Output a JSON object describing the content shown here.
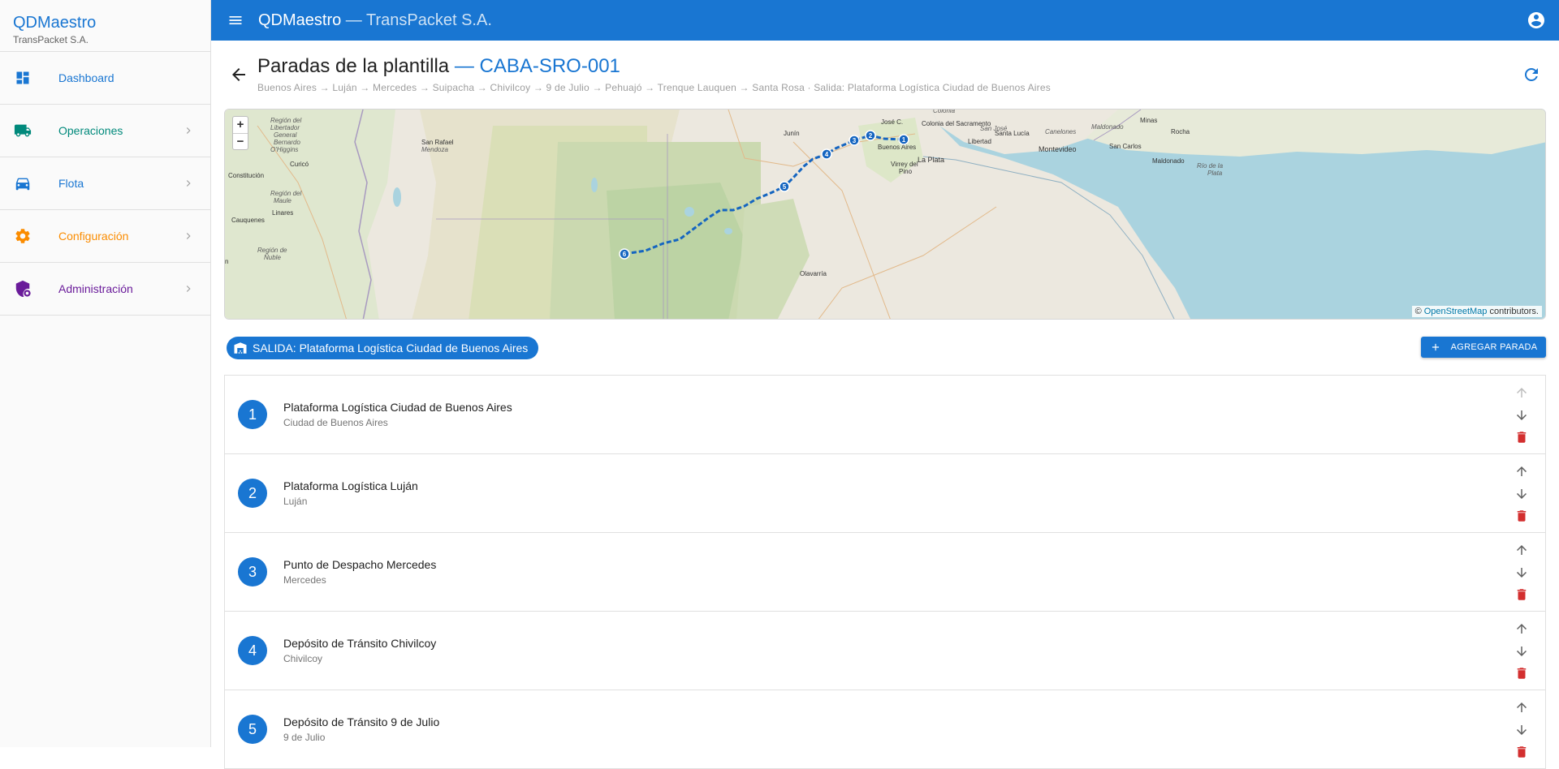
{
  "sidebar": {
    "brand_title": "QDMaestro",
    "brand_subtitle": "TransPacket S.A.",
    "items": [
      {
        "label": "Dashboard",
        "icon": "dashboard-icon",
        "color": "#1976d2"
      },
      {
        "label": "Operaciones",
        "icon": "truck-icon",
        "color": "#00897b"
      },
      {
        "label": "Flota",
        "icon": "car-icon",
        "color": "#1976d2"
      },
      {
        "label": "Configuración",
        "icon": "gear-icon",
        "color": "#fb8c00"
      },
      {
        "label": "Administración",
        "icon": "admin-shield-icon",
        "color": "#6a1b9a"
      }
    ]
  },
  "topbar": {
    "app_name": "QDMaestro",
    "company": " — TransPacket S.A.",
    "color": "#1976d2"
  },
  "page": {
    "title": "Paradas de la plantilla",
    "code": " — CABA-SRO-001",
    "route_summary": "Buenos Aires → Luján → Mercedes → Suipacha → Chivilcoy → 9 de Julio → Pehuajó → Trenque Lauquen → Santa Rosa · Salida: Plataforma Logística Ciudad de Buenos Aires"
  },
  "map": {
    "zoom_in": "+",
    "zoom_out": "−",
    "attribution_prefix": "© ",
    "attribution_link": "OpenStreetMap",
    "attribution_suffix": " contributors.",
    "labels": {
      "colonia": "Colonia",
      "colonia_sacramento": "Colonia del Sacramento",
      "san_jose": "San José",
      "santa_lucia": "Santa Lucía",
      "canelones": "Canelones",
      "maldonado_dept": "Maldonado",
      "minas": "Minas",
      "rocha": "Rocha",
      "libertad": "Libertad",
      "montevideo": "Montevideo",
      "san_carlos": "San Carlos",
      "maldonado": "Maldonado",
      "rio_plata": "Río de la Plata",
      "buenos_aires": "Buenos Aires",
      "virrey_del_pino": "Virrey del Pino",
      "la_plata": "La Plata",
      "jose_c": "José C.",
      "junin": "Junín",
      "san_rafael": "San Rafael",
      "mendoza": "Mendoza",
      "curico": "Curicó",
      "libertador": "Región del Libertador General Bernardo O'Higgins",
      "constitucion": "Constitución",
      "maule": "Región del Maule",
      "linares": "Linares",
      "cauquenes": "Cauquenes",
      "nuble": "Región de Ñuble",
      "olavarria": "Olavarría"
    },
    "markers": [
      "1",
      "2",
      "3",
      "4",
      "5",
      "6"
    ],
    "route_color": "#1565c0"
  },
  "departure_chip": "SALIDA: Plataforma Logística Ciudad de Buenos Aires",
  "add_button": "AGREGAR PARADA",
  "stops": [
    {
      "number": "1",
      "name": "Plataforma Logística Ciudad de Buenos Aires",
      "city": "Ciudad de Buenos Aires"
    },
    {
      "number": "2",
      "name": "Plataforma Logística Luján",
      "city": "Luján"
    },
    {
      "number": "3",
      "name": "Punto de Despacho Mercedes",
      "city": "Mercedes"
    },
    {
      "number": "4",
      "name": "Depósito de Tránsito Chivilcoy",
      "city": "Chivilcoy"
    },
    {
      "number": "5",
      "name": "Depósito de Tránsito 9 de Julio",
      "city": "9 de Julio"
    }
  ]
}
